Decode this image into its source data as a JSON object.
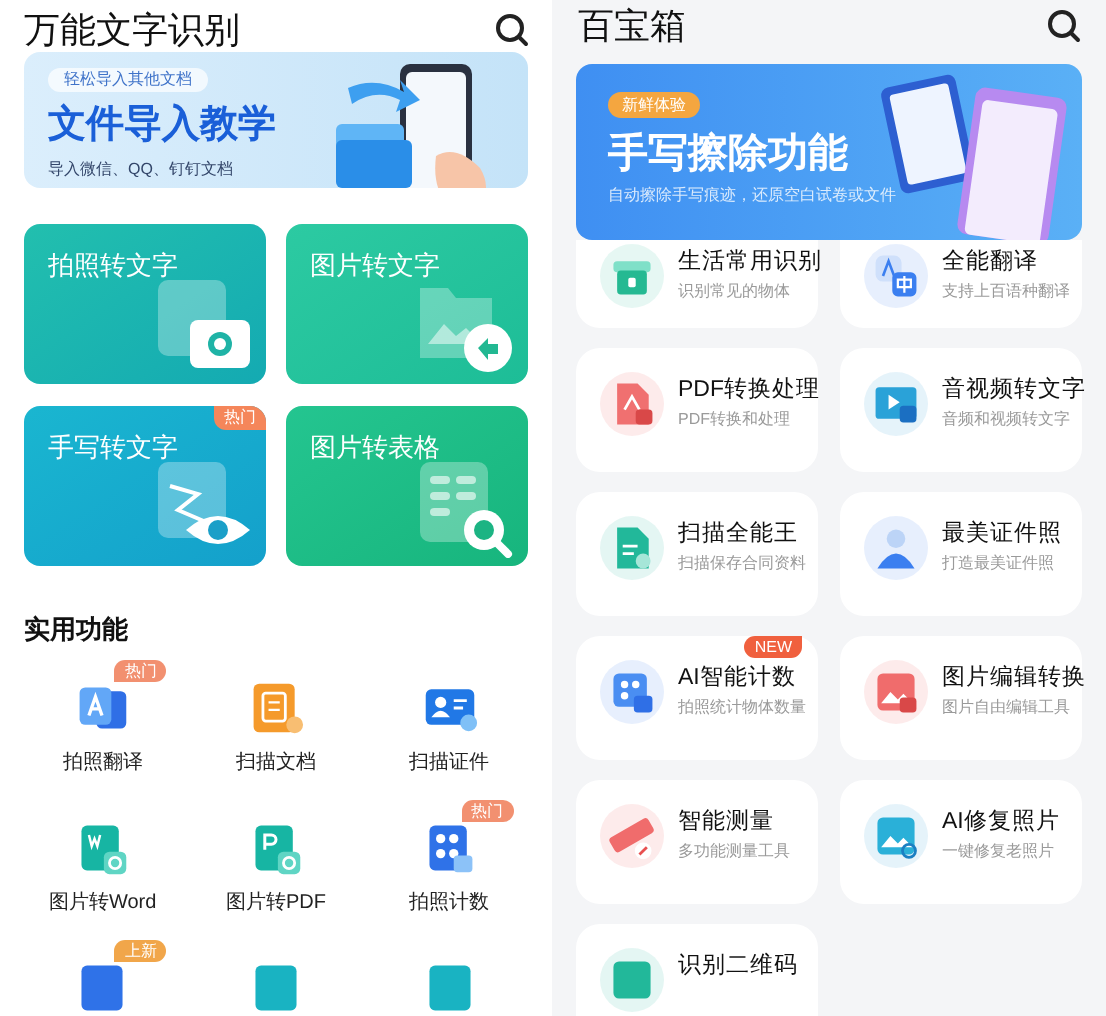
{
  "left": {
    "title": "万能文字识别",
    "banner": {
      "tag": "轻松导入其他文档",
      "title": "文件导入教学",
      "subtitle": "导入微信、QQ、钉钉文档"
    },
    "cards": [
      {
        "label": "拍照转文字",
        "kind": "camera"
      },
      {
        "label": "图片转文字",
        "kind": "image"
      },
      {
        "label": "手写转文字",
        "kind": "eye",
        "badge": "热门"
      },
      {
        "label": "图片转表格",
        "kind": "table"
      }
    ],
    "section_title": "实用功能",
    "tools": [
      {
        "label": "拍照翻译",
        "kind": "translate",
        "badge": "热门"
      },
      {
        "label": "扫描文档",
        "kind": "scan-doc"
      },
      {
        "label": "扫描证件",
        "kind": "id-card"
      },
      {
        "label": "图片转Word",
        "kind": "word"
      },
      {
        "label": "图片转PDF",
        "kind": "pdf-doc"
      },
      {
        "label": "拍照计数",
        "kind": "count",
        "badge": "热门"
      },
      {
        "kind": "blue-doc",
        "badge": "上新"
      },
      {
        "kind": "teal-doc"
      },
      {
        "kind": "teal-doc"
      }
    ]
  },
  "right": {
    "title": "百宝箱",
    "banner": {
      "tag": "新鲜体验",
      "title": "手写擦除功能",
      "subtitle": "自动擦除手写痕迹，还原空白试卷或文件"
    },
    "cards": [
      {
        "title": "生活常用识别",
        "subtitle": "识别常见的物体",
        "kind": "box"
      },
      {
        "title": "全能翻译",
        "subtitle": "支持上百语种翻译",
        "kind": "translate"
      },
      {
        "title": "PDF转换处理",
        "subtitle": "PDF转换和处理",
        "kind": "pdf"
      },
      {
        "title": "音视频转文字",
        "subtitle": "音频和视频转文字",
        "kind": "video"
      },
      {
        "title": "扫描全能王",
        "subtitle": "扫描保存合同资料",
        "kind": "scan"
      },
      {
        "title": "最美证件照",
        "subtitle": "打造最美证件照",
        "kind": "person"
      },
      {
        "title": "AI智能计数",
        "subtitle": "拍照统计物体数量",
        "kind": "count",
        "badge": "NEW"
      },
      {
        "title": "图片编辑转换",
        "subtitle": "图片自由编辑工具",
        "kind": "image-edit"
      },
      {
        "title": "智能测量",
        "subtitle": "多功能测量工具",
        "kind": "ruler"
      },
      {
        "title": "AI修复照片",
        "subtitle": "一键修复老照片",
        "kind": "photo-fix"
      },
      {
        "title": "识别二维码",
        "kind": "qrcode"
      }
    ]
  }
}
